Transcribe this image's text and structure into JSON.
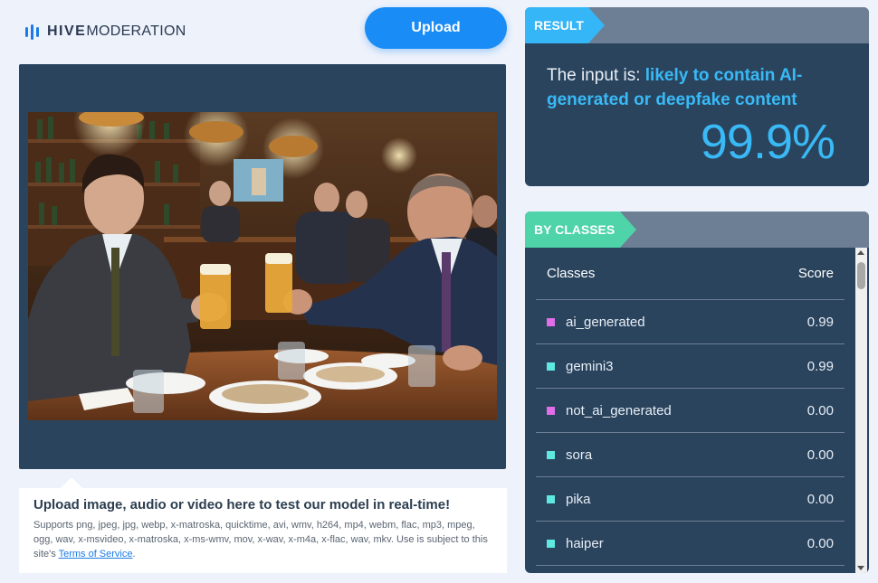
{
  "logo": {
    "brand_bold": "HIVE",
    "brand_light": "MODERATION"
  },
  "upload_button": "Upload",
  "info": {
    "title": "Upload image, audio or video here to test our model in real-time!",
    "supports": "Supports png, jpeg, jpg, webp, x-matroska, quicktime, avi, wmv, h264, mp4, webm, flac, mp3, mpeg, ogg, wav, x-msvideo, x-matroska, x-ms-wmv, mov, x-wav, x-m4a, x-flac, wav, mkv. Use is subject to this site's",
    "terms_link": "Terms of Service",
    "period": "."
  },
  "result": {
    "tag": "RESULT",
    "prefix": "The input is: ",
    "verdict": "likely to contain AI-generated or deepfake content",
    "percent": "99.9%"
  },
  "by_classes": {
    "tag": "BY CLASSES",
    "col_classes": "Classes",
    "col_score": "Score",
    "rows": [
      {
        "name": "ai_generated",
        "score": "0.99",
        "color": "#e06ee8"
      },
      {
        "name": "gemini3",
        "score": "0.99",
        "color": "#5ee8e0"
      },
      {
        "name": "not_ai_generated",
        "score": "0.00",
        "color": "#e06ee8"
      },
      {
        "name": "sora",
        "score": "0.00",
        "color": "#5ee8e0"
      },
      {
        "name": "pika",
        "score": "0.00",
        "color": "#5ee8e0"
      },
      {
        "name": "haiper",
        "score": "0.00",
        "color": "#5ee8e0"
      }
    ]
  },
  "colors": {
    "accent_blue": "#1a8cf5",
    "result_highlight": "#39b9f5",
    "panel_bg": "#2a445e",
    "tag_result": "#35b6f7",
    "tag_classes": "#4fd3a8"
  }
}
